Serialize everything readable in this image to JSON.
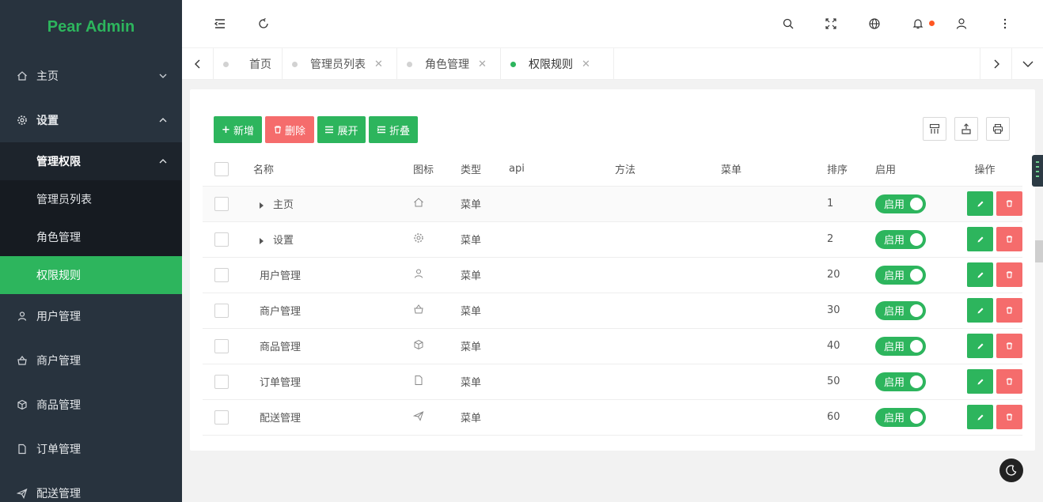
{
  "app": {
    "logo": "Pear Admin"
  },
  "sidebar": {
    "items": [
      {
        "label": "主页",
        "icon": "home-icon"
      },
      {
        "label": "设置",
        "icon": "gear-icon"
      }
    ],
    "submenu": {
      "head": "管理权限",
      "items": [
        {
          "label": "管理员列表"
        },
        {
          "label": "角色管理"
        },
        {
          "label": "权限规则",
          "active": true
        }
      ]
    },
    "rest": [
      {
        "label": "用户管理",
        "icon": "user-icon"
      },
      {
        "label": "商户管理",
        "icon": "merchant-icon"
      },
      {
        "label": "商品管理",
        "icon": "box-icon"
      },
      {
        "label": "订单管理",
        "icon": "file-icon"
      },
      {
        "label": "配送管理",
        "icon": "send-icon"
      }
    ]
  },
  "tabs": [
    {
      "label": "首页"
    },
    {
      "label": "管理员列表"
    },
    {
      "label": "角色管理"
    },
    {
      "label": "权限规则",
      "active": true
    }
  ],
  "toolbar": {
    "add": "新增",
    "delete": "删除",
    "expand": "展开",
    "collapse": "折叠"
  },
  "table": {
    "headers": [
      "名称",
      "图标",
      "类型",
      "api",
      "方法",
      "菜单",
      "排序",
      "启用",
      "操作"
    ],
    "rows": [
      {
        "name": "主页",
        "type": "菜单",
        "sort": "1",
        "enabled": "启用",
        "expandable": true
      },
      {
        "name": "设置",
        "type": "菜单",
        "sort": "2",
        "enabled": "启用",
        "expandable": true
      },
      {
        "name": "用户管理",
        "type": "菜单",
        "sort": "20",
        "enabled": "启用"
      },
      {
        "name": "商户管理",
        "type": "菜单",
        "sort": "30",
        "enabled": "启用"
      },
      {
        "name": "商品管理",
        "type": "菜单",
        "sort": "40",
        "enabled": "启用"
      },
      {
        "name": "订单管理",
        "type": "菜单",
        "sort": "50",
        "enabled": "启用"
      },
      {
        "name": "配送管理",
        "type": "菜单",
        "sort": "60",
        "enabled": "启用"
      }
    ]
  },
  "colors": {
    "accent": "#2db55d",
    "danger": "#f56c6c",
    "sidebar": "#28333e"
  }
}
